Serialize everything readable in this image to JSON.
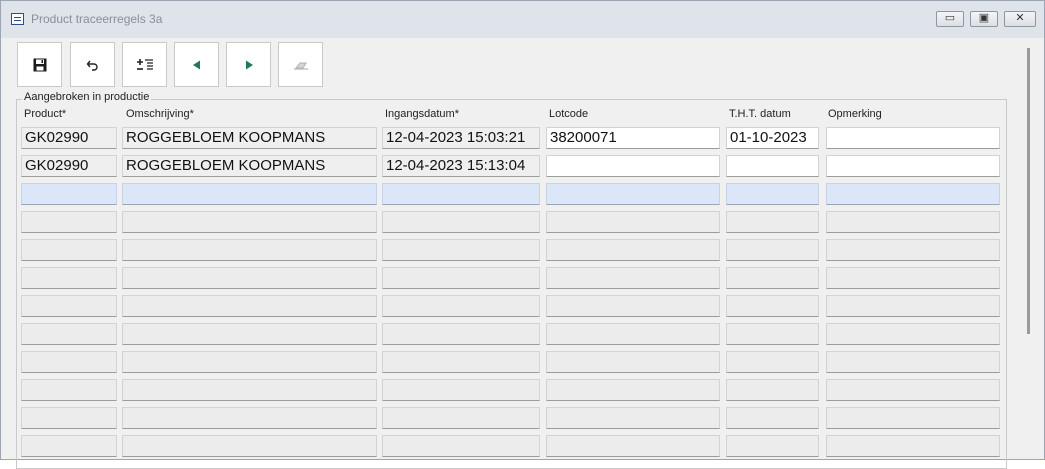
{
  "window": {
    "title": "Product traceerregels 3a",
    "controls": {
      "minimize": "▭",
      "maximize": "▣",
      "close": "✕"
    }
  },
  "toolbar": {
    "buttons": [
      {
        "name": "save",
        "icon": "save-icon"
      },
      {
        "name": "undo",
        "icon": "undo-icon"
      },
      {
        "name": "add-row",
        "icon": "add-row-icon"
      },
      {
        "name": "previous",
        "icon": "arrow-left-icon"
      },
      {
        "name": "next",
        "icon": "arrow-right-icon"
      },
      {
        "name": "erase",
        "icon": "eraser-icon"
      }
    ]
  },
  "group": {
    "label": "Aangebroken in productie",
    "columns": [
      "Product*",
      "Omschrijving*",
      "Ingangsdatum*",
      "Lotcode",
      "T.H.T. datum",
      "Opmerking"
    ],
    "rows": [
      [
        "GK02990",
        "ROGGEBLOEM KOOPMANS",
        "12-04-2023 15:03:21",
        "38200071",
        "01-10-2023",
        ""
      ],
      [
        "GK02990",
        "ROGGEBLOEM KOOPMANS",
        "12-04-2023 15:13:04",
        "",
        "",
        ""
      ],
      [
        "",
        "",
        "",
        "",
        "",
        ""
      ],
      [
        "",
        "",
        "",
        "",
        "",
        ""
      ],
      [
        "",
        "",
        "",
        "",
        "",
        ""
      ],
      [
        "",
        "",
        "",
        "",
        "",
        ""
      ],
      [
        "",
        "",
        "",
        "",
        "",
        ""
      ],
      [
        "",
        "",
        "",
        "",
        "",
        ""
      ],
      [
        "",
        "",
        "",
        "",
        "",
        ""
      ],
      [
        "",
        "",
        "",
        "",
        "",
        ""
      ],
      [
        "",
        "",
        "",
        "",
        "",
        ""
      ],
      [
        "",
        "",
        "",
        "",
        "",
        ""
      ]
    ]
  },
  "colors": {
    "selected_row": "#dbe7f8",
    "arrow_green": "#1d7a5c"
  }
}
